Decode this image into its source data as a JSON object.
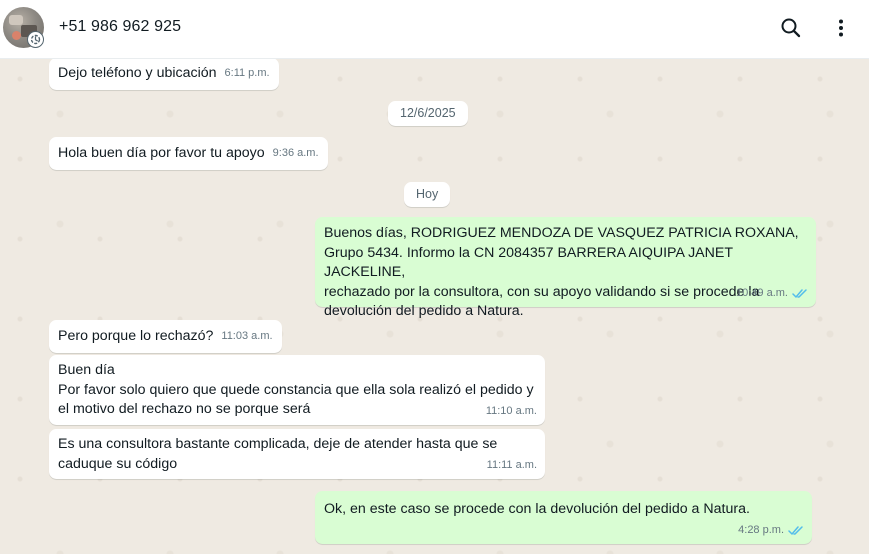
{
  "header": {
    "contact_name": "+51 986 962 925",
    "search_icon": "search-icon",
    "menu_icon": "more-vertical-icon"
  },
  "chat": {
    "dates": [
      "12/6/2025",
      "Hoy"
    ],
    "messages": [
      {
        "direction": "in",
        "text": "Dejo teléfono y ubicación",
        "time": "6:11 p.m."
      },
      {
        "direction": "in",
        "text": "Hola buen día por favor tu apoyo",
        "time": "9:36 a.m."
      },
      {
        "direction": "out",
        "text": "Buenos días, RODRIGUEZ MENDOZA DE VASQUEZ PATRICIA ROXANA,\nGrupo 5434. Informo la CN 2084357 BARRERA AIQUIPA JANET JACKELINE,\nrechazado por la consultora, con su apoyo validando si se procede la\ndevolución del pedido a Natura.",
        "time": "10:49 a.m.",
        "status": "read"
      },
      {
        "direction": "in",
        "text": "Pero porque lo rechazó?",
        "time": "11:03 a.m."
      },
      {
        "direction": "in",
        "text": "Buen día\nPor favor solo quiero que quede constancia que ella sola realizó el pedido y\nel motivo del rechazo no se porque será",
        "time": "11:10 a.m."
      },
      {
        "direction": "in",
        "text": "Es una consultora bastante complicada, deje de atender hasta que se\ncaduque su código",
        "time": "11:11 a.m."
      },
      {
        "direction": "out",
        "text": "Ok, en este caso se procede con la devolución del pedido a Natura.",
        "time": "4:28 p.m.",
        "status": "read"
      }
    ]
  },
  "colors": {
    "incoming_bubble": "#ffffff",
    "outgoing_bubble": "#d9fdd3",
    "chat_background": "#efeae2",
    "read_ticks": "#53bdeb"
  }
}
